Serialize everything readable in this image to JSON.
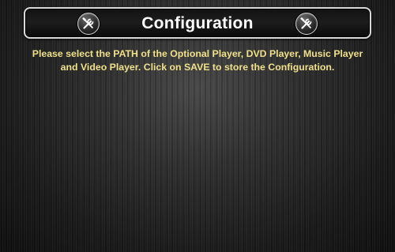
{
  "header": {
    "title": "Configuration",
    "left_icon": "tools-icon",
    "right_icon": "tools-icon"
  },
  "main": {
    "instructions": "Please select the PATH of the Optional Player, DVD Player, Music Player and Video Player.  Click on SAVE to store the Configuration."
  },
  "colors": {
    "title_text": "#ffffff",
    "instruction_text": "#f0e08a",
    "frame_border": "#d8d8d8",
    "background": "#1a1a1a"
  }
}
